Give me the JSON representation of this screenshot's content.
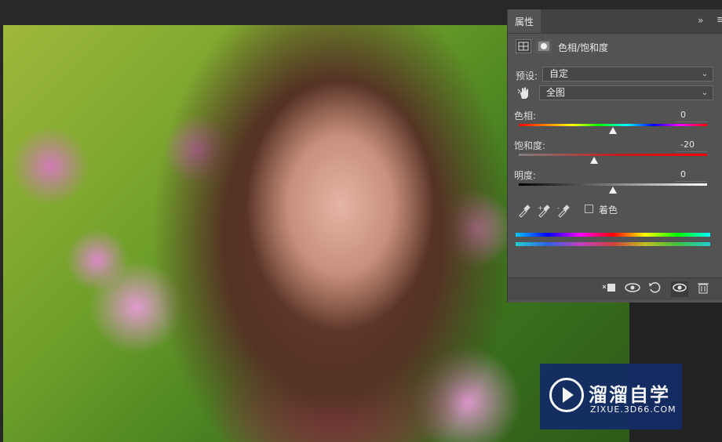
{
  "panel": {
    "tab_label": "属性",
    "collapse_glyph": "»",
    "menu_glyph": "≡",
    "adjustment_title": "色相/饱和度",
    "preset_label": "预设:",
    "preset_value": "自定",
    "channel_value": "全图",
    "hue": {
      "label": "色相:",
      "value": "0",
      "level": 0.5
    },
    "saturation": {
      "label": "饱和度:",
      "value": "-20",
      "level": 0.4
    },
    "lightness": {
      "label": "明度:",
      "value": "0",
      "level": 0.5
    },
    "colorize_label": "着色",
    "icons": {
      "adjustment": "hue-saturation-layer-icon",
      "mask": "mask-icon",
      "target": "targeted-adjustment-hand-icon",
      "eyedroppers": [
        "eyedropper-icon",
        "eyedropper-plus-icon",
        "eyedropper-minus-icon"
      ],
      "bottom": [
        "clip-to-layer-icon",
        "view-previous-state-icon",
        "reset-icon",
        "visibility-eye-icon",
        "trash-icon"
      ]
    }
  },
  "watermark": {
    "title": "溜溜自学",
    "url": "ZIXUE.3D66.COM"
  },
  "colors": {
    "panel_bg": "#535353",
    "workspace_bg": "#282828",
    "watermark_bg": "#142c66"
  }
}
